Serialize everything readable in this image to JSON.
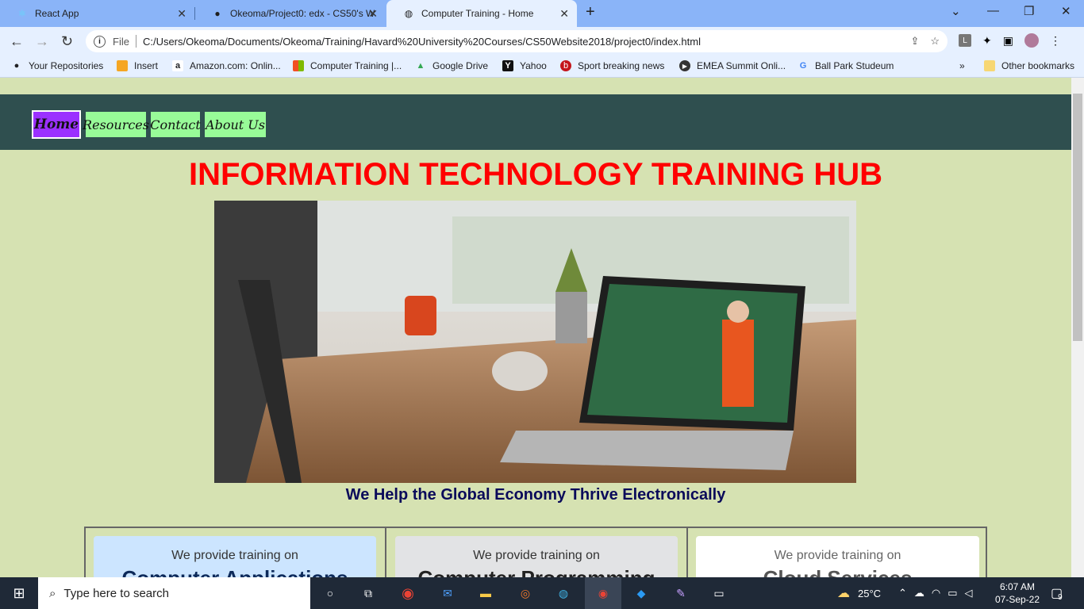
{
  "browser": {
    "tabs": [
      {
        "title": "React App",
        "icon": "react-icon"
      },
      {
        "title": "Okeoma/Project0: edx - CS50's W",
        "icon": "github-icon"
      },
      {
        "title": "Computer Training - Home",
        "icon": "globe-icon"
      }
    ],
    "url_scheme_label": "File",
    "url": "C:/Users/Okeoma/Documents/Okeoma/Training/Havard%20University%20Courses/CS50Website2018/project0/index.html",
    "bookmarks": [
      {
        "label": "Your Repositories",
        "icon": "github-icon"
      },
      {
        "label": "Insert",
        "icon": "bookmark-orange-icon"
      },
      {
        "label": "Amazon.com: Onlin...",
        "icon": "amazon-icon"
      },
      {
        "label": "Computer Training |...",
        "icon": "microsoft-icon"
      },
      {
        "label": "Google Drive",
        "icon": "drive-icon"
      },
      {
        "label": "Yahoo",
        "icon": "yahoo-icon"
      },
      {
        "label": "Sport breaking news",
        "icon": "sport-icon"
      },
      {
        "label": "EMEA Summit Onli...",
        "icon": "play-icon"
      },
      {
        "label": "Ball Park Studeum",
        "icon": "google-icon"
      }
    ],
    "other_bookmarks": "Other bookmarks",
    "more_bookmarks": "»",
    "new_tab": "+"
  },
  "site": {
    "nav": [
      "Home",
      "Resources",
      "Contact",
      "About Us"
    ],
    "headline": "INFORMATION TECHNOLOGY TRAINING HUB",
    "tagline": "We Help the Global Economy Thrive Electronically",
    "cards": [
      {
        "prefix": "We provide training on",
        "title": "Computer Applications"
      },
      {
        "prefix": "We provide training on",
        "title": "Computer Programming"
      },
      {
        "prefix": "We provide training on",
        "title": "Cloud Services"
      }
    ],
    "colors": {
      "nav_bg": "#2f4f4f",
      "nav_item": "#98fb98",
      "nav_active": "#9b30ff",
      "headline": "#ff0000",
      "page_bg": "#d6e2b2"
    }
  },
  "taskbar": {
    "search_placeholder": "Type here to search",
    "weather": "25°C",
    "time": "6:07 AM",
    "date": "07-Sep-22",
    "notifications": "9"
  }
}
